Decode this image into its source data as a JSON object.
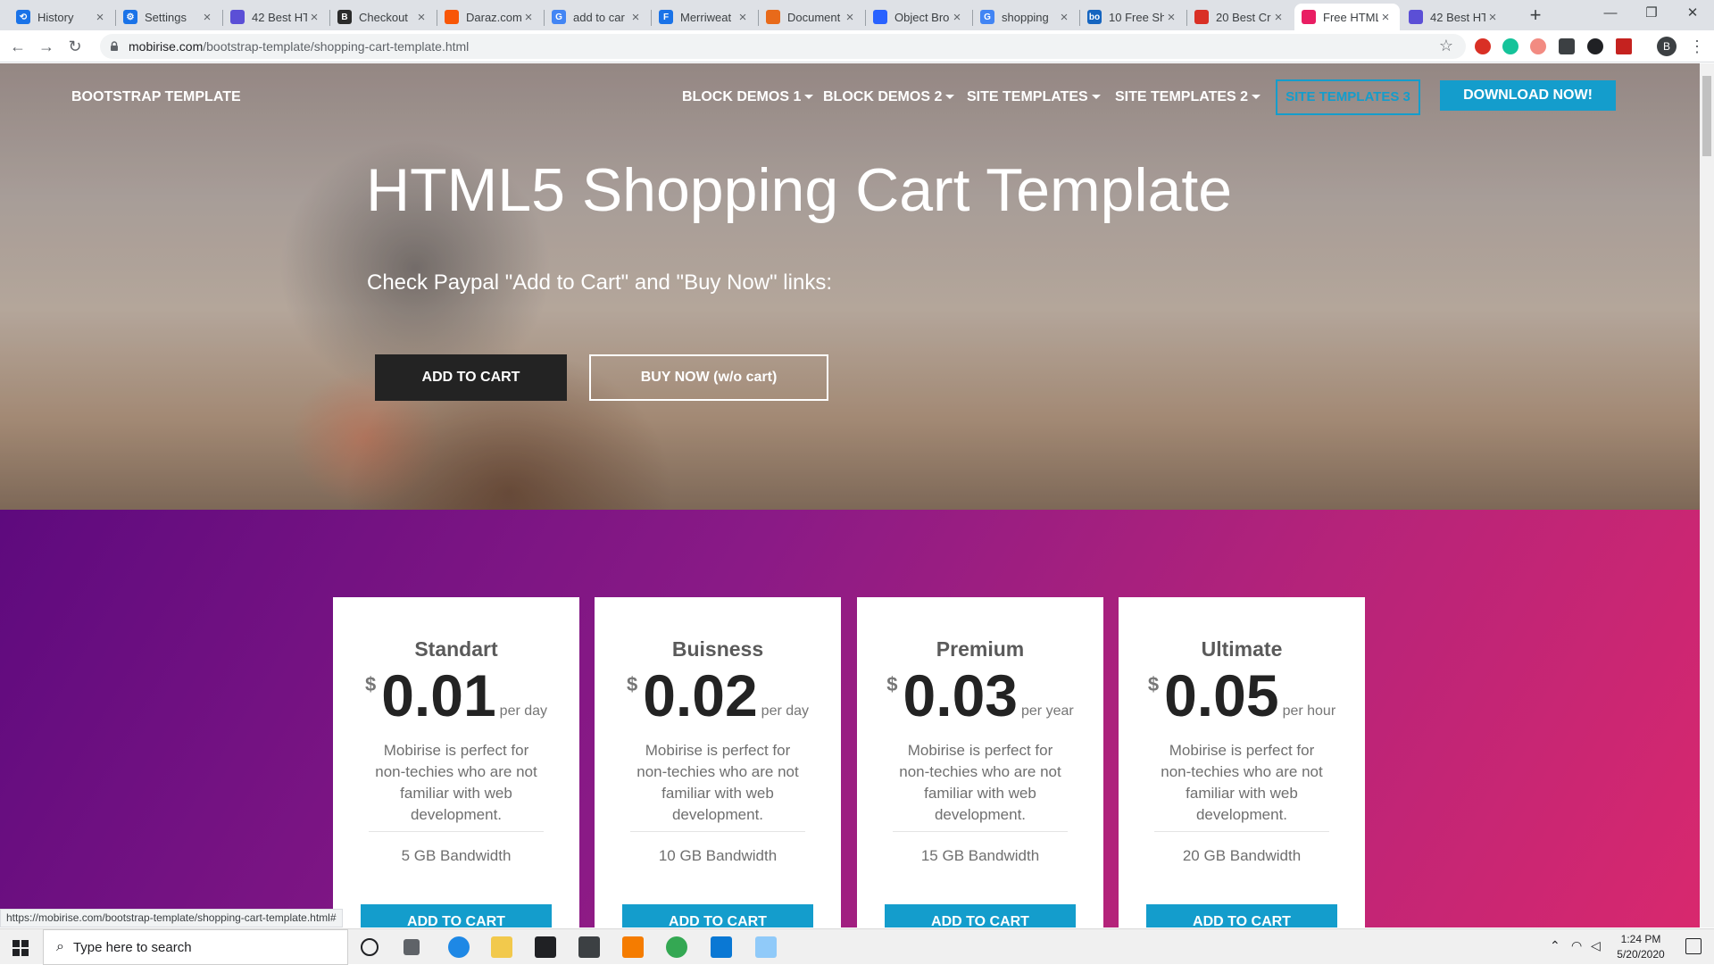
{
  "browser": {
    "tabs": [
      {
        "title": "History",
        "color": "#1a73e8",
        "glyph": "⟲",
        "active": false
      },
      {
        "title": "Settings",
        "color": "#1a73e8",
        "glyph": "⚙",
        "active": false
      },
      {
        "title": "42 Best HT",
        "color": "#5b4fd6",
        "glyph": "",
        "active": false
      },
      {
        "title": "Checkout",
        "color": "#2b2b2b",
        "glyph": "B",
        "active": false
      },
      {
        "title": "Daraz.com",
        "color": "#f85606",
        "glyph": "",
        "active": false
      },
      {
        "title": "add to car",
        "color": "#4285f4",
        "glyph": "G",
        "active": false
      },
      {
        "title": "Merriweat",
        "color": "#1a73e8",
        "glyph": "F",
        "active": false
      },
      {
        "title": "Document",
        "color": "#e86a1a",
        "glyph": "",
        "active": false
      },
      {
        "title": "Object Bro",
        "color": "#2962ff",
        "glyph": "",
        "active": false
      },
      {
        "title": "shopping",
        "color": "#4285f4",
        "glyph": "G",
        "active": false
      },
      {
        "title": "10 Free Sh",
        "color": "#1565c0",
        "glyph": "bo",
        "active": false
      },
      {
        "title": "20 Best Cr",
        "color": "#d93025",
        "glyph": "",
        "active": false
      },
      {
        "title": "Free HTML",
        "color": "#e91e63",
        "glyph": "",
        "active": true
      },
      {
        "title": "42 Best HT",
        "color": "#5b4fd6",
        "glyph": "",
        "active": false
      }
    ],
    "url_host": "mobirise.com",
    "url_path": "/bootstrap-template/shopping-cart-template.html",
    "profile_initial": "B",
    "status_url": "https://mobirise.com/bootstrap-template/shopping-cart-template.html#"
  },
  "navbar": {
    "brand": "BOOTSTRAP TEMPLATE",
    "links": [
      "BLOCK DEMOS 1",
      "BLOCK DEMOS 2",
      "SITE TEMPLATES",
      "SITE TEMPLATES 2"
    ],
    "outline_button": "SITE TEMPLATES 3",
    "download_button": "DOWNLOAD NOW!"
  },
  "hero": {
    "title": "HTML5 Shopping Cart Template",
    "subtitle": "Check Paypal \"Add to Cart\" and \"Buy Now\" links:",
    "primary_button": "ADD TO CART",
    "secondary_button": "BUY NOW (w/o cart)"
  },
  "pricing": {
    "currency": "$",
    "plans": [
      {
        "name": "Standart",
        "price": "0.01",
        "period": "per day",
        "description": "Mobirise is perfect for non-techies who are not familiar with web development.",
        "bandwidth": "5 GB Bandwidth",
        "button": "ADD TO CART"
      },
      {
        "name": "Buisness",
        "price": "0.02",
        "period": "per day",
        "description": "Mobirise is perfect for non-techies who are not familiar with web development.",
        "bandwidth": "10 GB Bandwidth",
        "button": "ADD TO CART"
      },
      {
        "name": "Premium",
        "price": "0.03",
        "period": "per year",
        "description": "Mobirise is perfect for non-techies who are not familiar with web development.",
        "bandwidth": "15 GB Bandwidth",
        "button": "ADD TO CART"
      },
      {
        "name": "Ultimate",
        "price": "0.05",
        "period": "per hour",
        "description": "Mobirise is perfect for non-techies who are not familiar with web development.",
        "bandwidth": "20 GB Bandwidth",
        "button": "ADD TO CART"
      }
    ]
  },
  "taskbar": {
    "search_placeholder": "Type here to search",
    "time": "1:24 PM",
    "date": "5/20/2020"
  },
  "colors": {
    "accent": "#149dcc",
    "pricing_gradient_start": "#5e0a7e",
    "pricing_gradient_end": "#d8286e"
  }
}
